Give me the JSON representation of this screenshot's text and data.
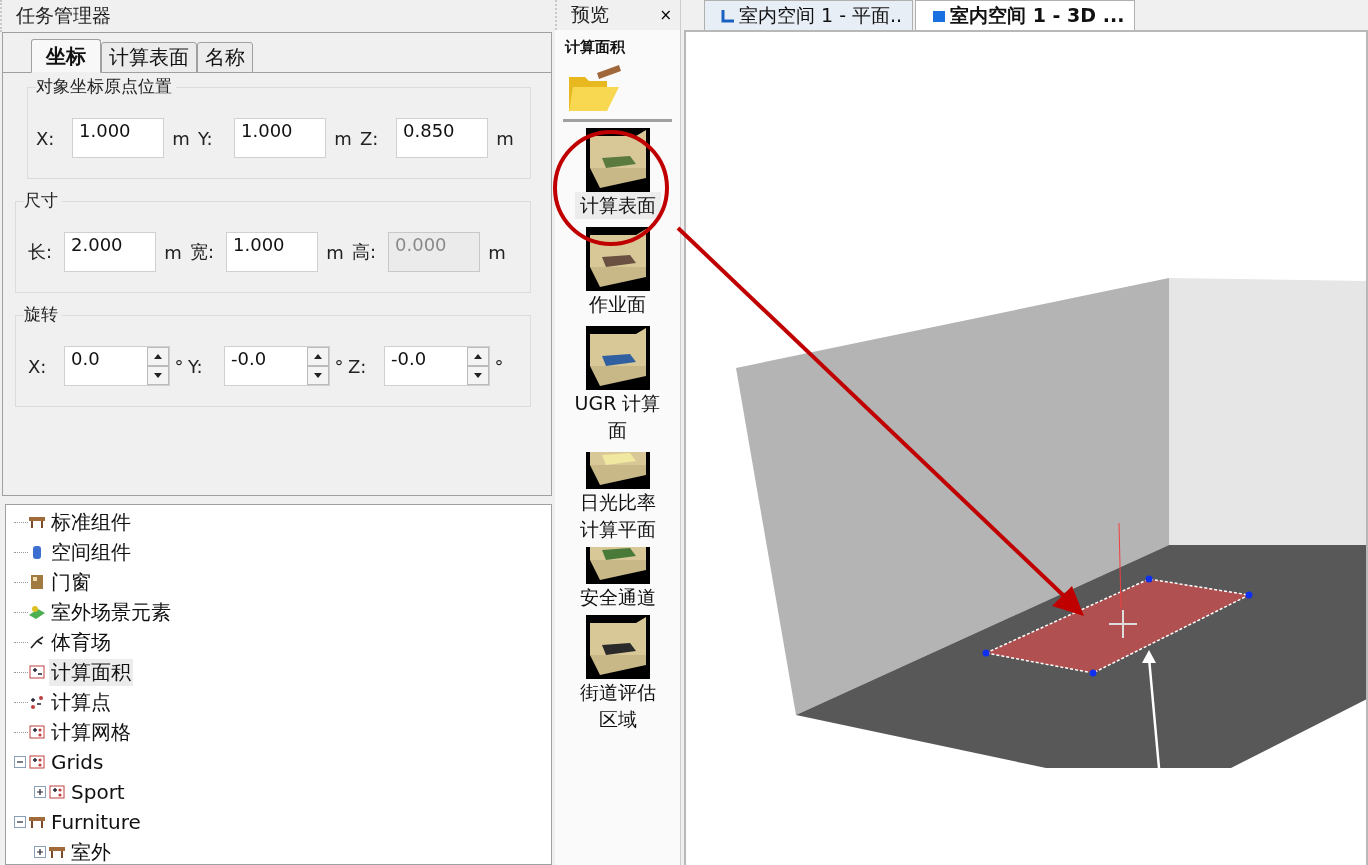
{
  "task_manager": {
    "title": "任务管理器",
    "tabs": [
      {
        "label": "坐标",
        "selected": true
      },
      {
        "label": "计算表面",
        "selected": false
      },
      {
        "label": "名称",
        "selected": false
      }
    ],
    "groups": [
      {
        "title": "对象坐标原点位置",
        "kind": "text",
        "fields": [
          {
            "label": "X:",
            "value": "1.000",
            "unit": "m",
            "disabled": false
          },
          {
            "label": "Y:",
            "value": "1.000",
            "unit": "m",
            "disabled": false
          },
          {
            "label": "Z:",
            "value": "0.850",
            "unit": "m",
            "disabled": false
          }
        ]
      },
      {
        "title": "尺寸",
        "kind": "text",
        "fields": [
          {
            "label": "长:",
            "value": "2.000",
            "unit": "m",
            "disabled": false
          },
          {
            "label": "宽:",
            "value": "1.000",
            "unit": "m",
            "disabled": false
          },
          {
            "label": "高:",
            "value": "0.000",
            "unit": "m",
            "disabled": true
          }
        ]
      },
      {
        "title": "旋转",
        "kind": "spin",
        "fields": [
          {
            "label": "X:",
            "value": "0.0",
            "unit": "°"
          },
          {
            "label": "Y:",
            "value": "-0.0",
            "unit": "°"
          },
          {
            "label": "Z:",
            "value": "-0.0",
            "unit": "°"
          }
        ]
      }
    ]
  },
  "tree": [
    {
      "label": "标准组件",
      "kind": "furniture",
      "selected": false
    },
    {
      "label": "空间组件",
      "kind": "space",
      "selected": false
    },
    {
      "label": "门窗",
      "kind": "door",
      "selected": false
    },
    {
      "label": "室外场景元素",
      "kind": "outdoor",
      "selected": false
    },
    {
      "label": "体育场",
      "kind": "sport",
      "selected": false
    },
    {
      "label": "计算面积",
      "kind": "area",
      "selected": true
    },
    {
      "label": "计算点",
      "kind": "point",
      "selected": false
    },
    {
      "label": "计算网格",
      "kind": "grid",
      "selected": false
    },
    {
      "label": "Grids",
      "kind": "grid",
      "selected": false,
      "expanded": true,
      "children": [
        {
          "label": "Sport",
          "kind": "grid",
          "selected": false,
          "expanded": false
        }
      ]
    },
    {
      "label": "Furniture",
      "kind": "furniture",
      "selected": false,
      "expanded": true,
      "children": [
        {
          "label": "室外",
          "kind": "furniture",
          "selected": false,
          "expanded": false
        }
      ]
    }
  ],
  "preview": {
    "title": "预览",
    "close": "×",
    "heading": "计算面积",
    "items": [
      {
        "label": "计算表面",
        "kind": "surface",
        "selected": true,
        "cropped": false
      },
      {
        "label": "作业面",
        "kind": "workplane",
        "selected": false,
        "cropped": false
      },
      {
        "label": "UGR 计算面",
        "kind": "ugr",
        "selected": false,
        "cropped": false
      },
      {
        "label": "日光比率计算平面",
        "kind": "daylight",
        "selected": false,
        "cropped": true
      },
      {
        "label": "安全通道",
        "kind": "escape",
        "selected": false,
        "cropped": true
      },
      {
        "label": "街道评估区域",
        "kind": "street",
        "selected": false,
        "cropped": false
      }
    ]
  },
  "viewport": {
    "tabs": [
      {
        "label": "室内空间 1 - 平面..",
        "kind": "plan",
        "selected": false
      },
      {
        "label": "室内空间 1 - 3D ...",
        "kind": "model",
        "selected": true
      }
    ]
  }
}
